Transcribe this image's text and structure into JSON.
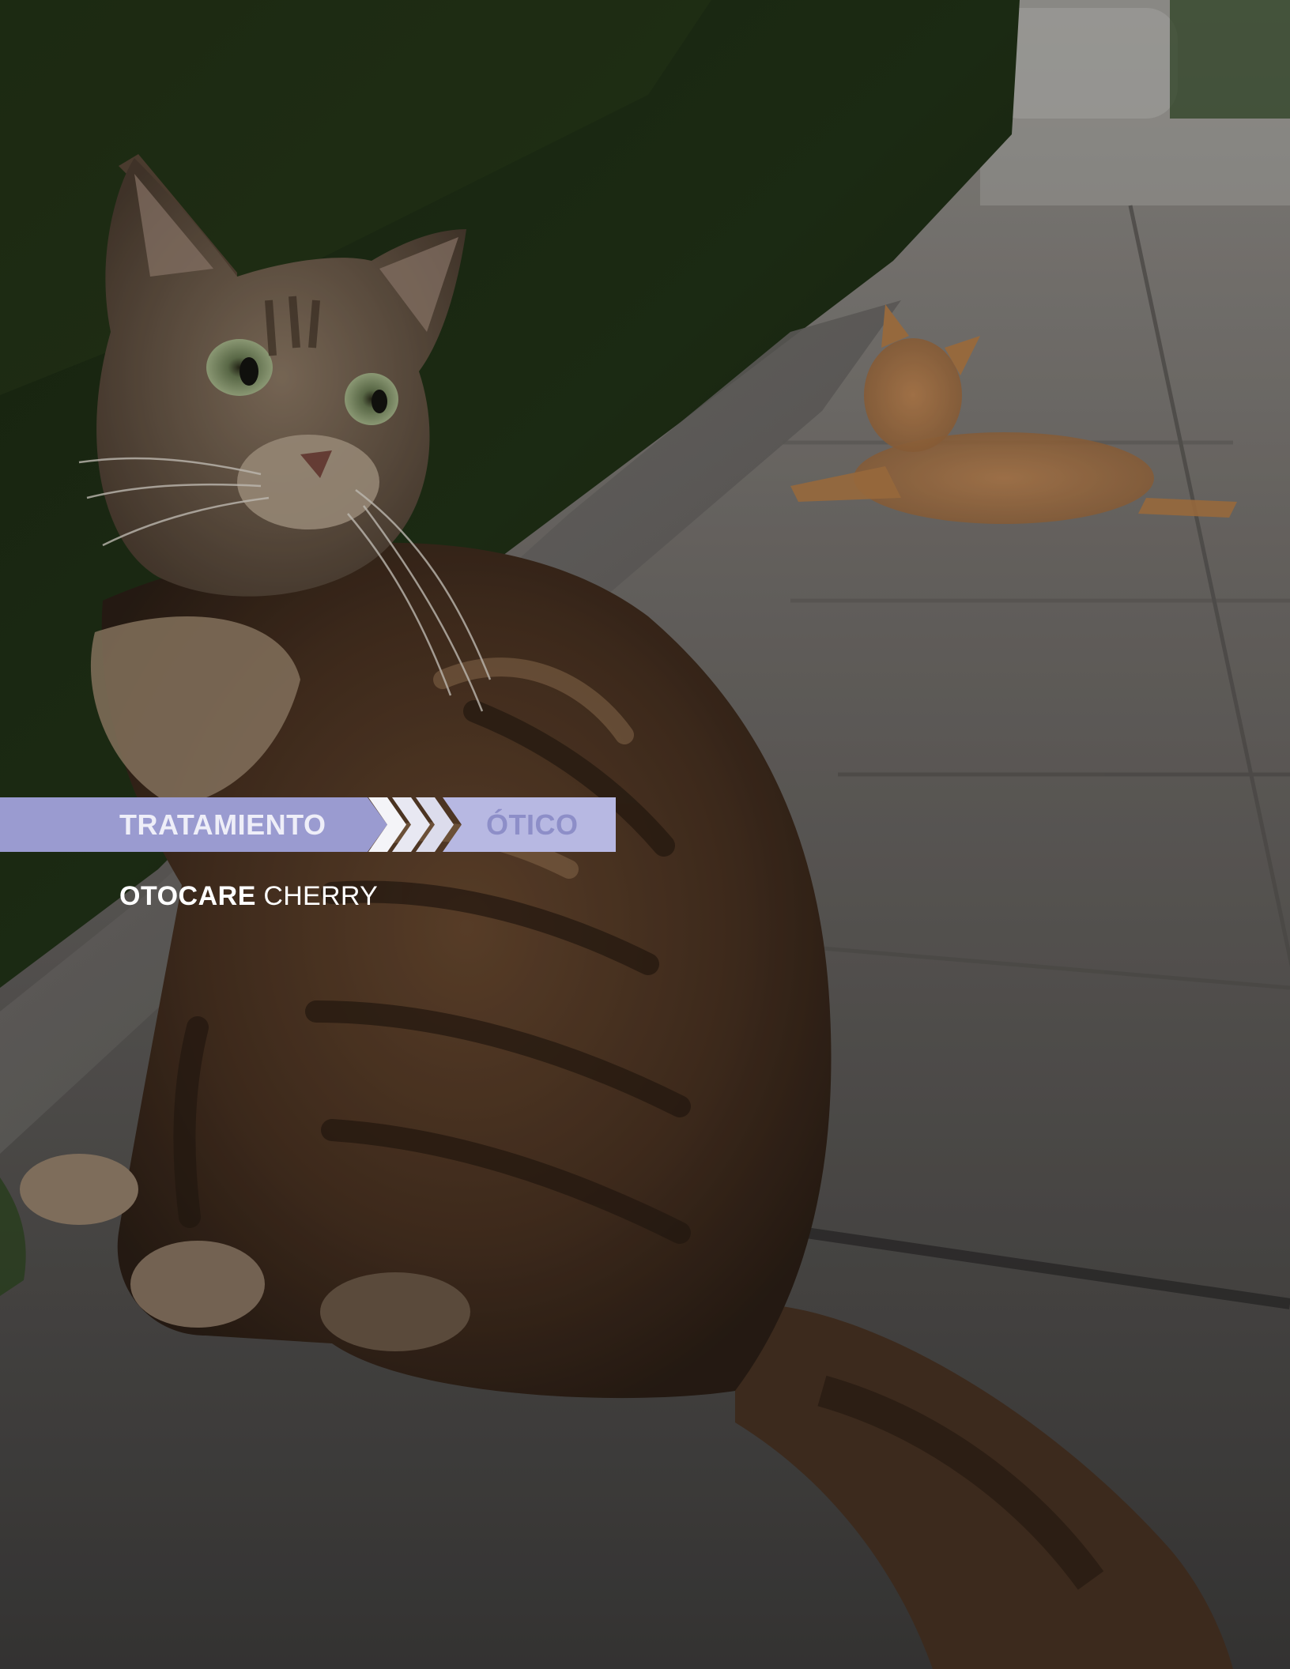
{
  "banner": {
    "left_label": "TRATAMIENTO",
    "right_label": "ÓTICO",
    "colors": {
      "left_band": "#9a9bd0",
      "right_band": "#b7b8e2",
      "right_text": "#8d8ec8",
      "chevron": "#f4f4f8"
    }
  },
  "product": {
    "brand": "OTOCARE",
    "variant": "CHERRY"
  },
  "photo": {
    "description_icon": "cats-on-sidewalk-photo"
  }
}
